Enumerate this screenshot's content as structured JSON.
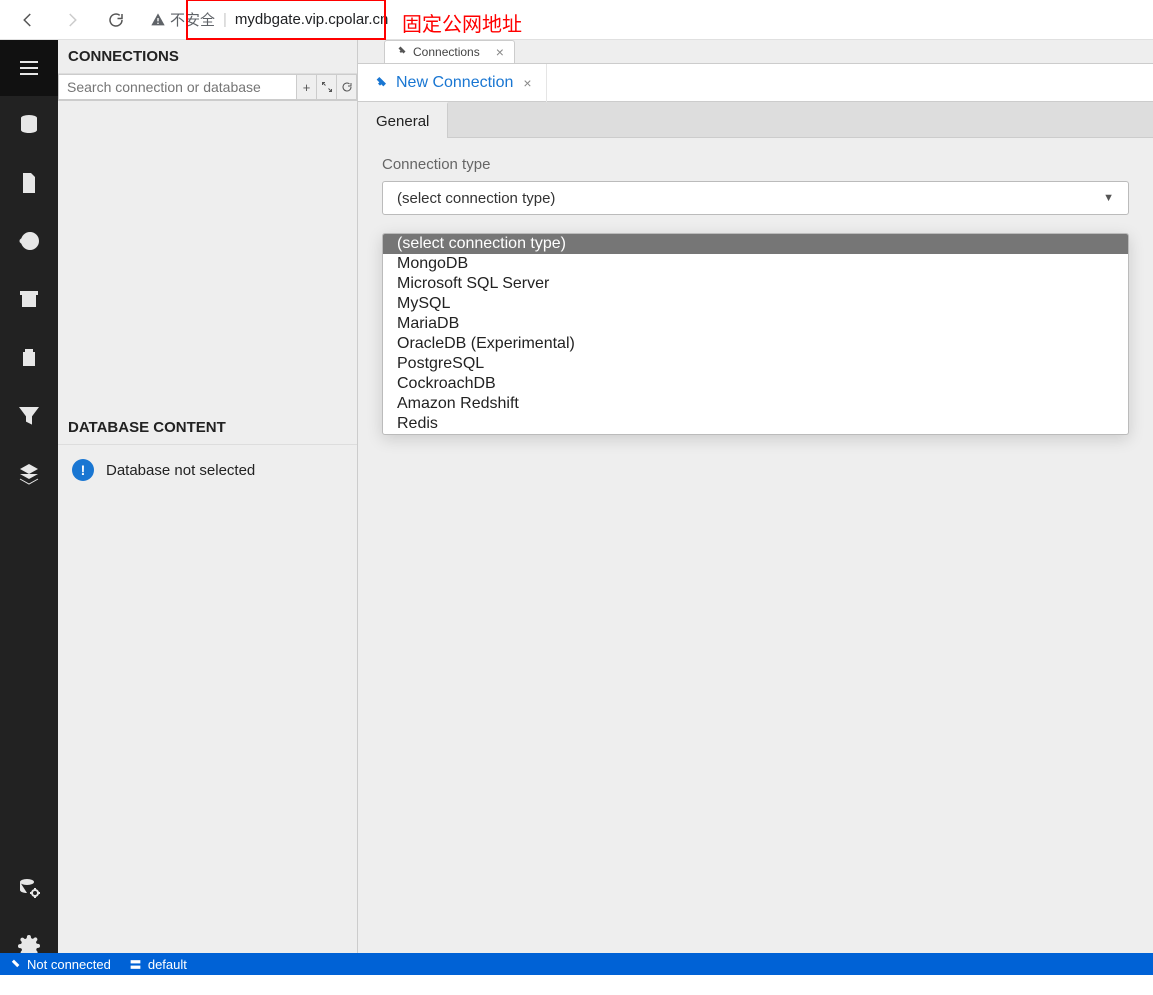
{
  "browser": {
    "insecure_label": "不安全",
    "url": "mydbgate.vip.cpolar.cn",
    "annotation_text": "固定公网地址"
  },
  "rail_icons": [
    "menu",
    "database",
    "file",
    "history",
    "archive",
    "filter",
    "layers",
    "db-settings",
    "gear"
  ],
  "leftpanel": {
    "connections_header": "CONNECTIONS",
    "search_placeholder": "Search connection or database",
    "btn_add": "+",
    "btn_expand": "⇄",
    "btn_refresh": "⟳",
    "db_header": "DATABASE CONTENT",
    "db_msg": "Database not selected"
  },
  "tabs": {
    "file_tab_label": "Connections",
    "content_tab_label": "New Connection",
    "sub_tab_label": "General"
  },
  "form": {
    "conn_type_label": "Connection type",
    "select_placeholder": "(select connection type)",
    "options": [
      "(select connection type)",
      "MongoDB",
      "Microsoft SQL Server",
      "MySQL",
      "MariaDB",
      "OracleDB (Experimental)",
      "PostgreSQL",
      "CockroachDB",
      "Amazon Redshift",
      "Redis"
    ]
  },
  "statusbar": {
    "status": "Not connected",
    "profile": "default"
  }
}
